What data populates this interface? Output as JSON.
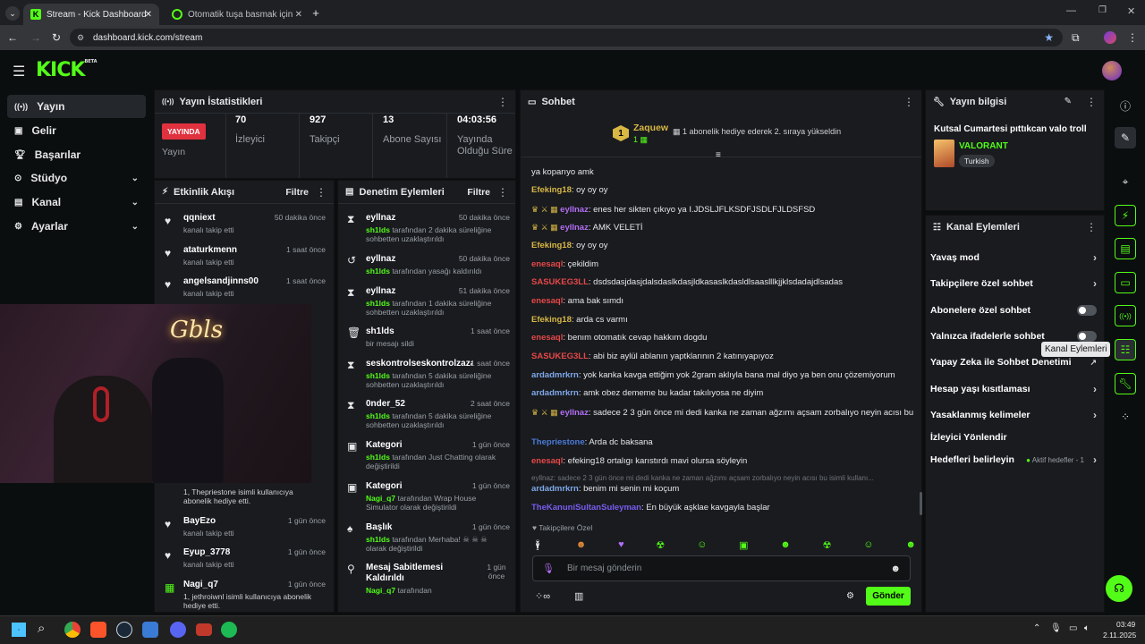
{
  "browser": {
    "tabs": [
      {
        "title": "Stream - Kick Dashboard"
      },
      {
        "title": "Otomatik tuşa basmak için prog..."
      }
    ],
    "url": "dashboard.kick.com/stream"
  },
  "kick": {
    "logo": "KICK",
    "beta": "BETA"
  },
  "nav": [
    {
      "label": "Yayın",
      "icon": "broadcast-icon"
    },
    {
      "label": "Gelir",
      "icon": "revenue-icon"
    },
    {
      "label": "Başarılar",
      "icon": "trophy-icon"
    },
    {
      "label": "Stüdyo",
      "icon": "studio-icon"
    },
    {
      "label": "Kanal",
      "icon": "channel-icon"
    },
    {
      "label": "Ayarlar",
      "icon": "settings-icon"
    }
  ],
  "stats": {
    "title": "Yayın İstatistikleri",
    "live_badge": "YAYINDA",
    "live_label": "Yayın",
    "viewers": "70",
    "viewers_label": "İzleyici",
    "followers": "927",
    "followers_label": "Takipçi",
    "subs": "13",
    "subs_label": "Abone Sayısı",
    "duration": "04:03:56",
    "duration_label": "Yayında Olduğu Süre"
  },
  "activity": {
    "title": "Etkinlik Akışı",
    "filter": "Filtre",
    "items": [
      {
        "name": "qqniext",
        "sub": "kanalı takip etti",
        "time": "50 dakika önce"
      },
      {
        "name": "ataturkmenn",
        "sub": "kanalı takip etti",
        "time": "1 saat önce"
      },
      {
        "name": "angelsandjinns00",
        "sub": "kanalı takip etti",
        "time": "1 saat önce"
      },
      {
        "name": "",
        "sub": "1, Thepriestone isimli kullanıcıya abonelik hediye etti.",
        "time": ""
      },
      {
        "name": "BayEzo",
        "sub": "kanalı takip etti",
        "time": "1 gün önce"
      },
      {
        "name": "Eyup_3778",
        "sub": "kanalı takip etti",
        "time": "1 gün önce"
      },
      {
        "name": "Nagi_q7",
        "sub": "1, jethroiwnl isimli kullanıcıya abonelik hediye etti.",
        "time": "1 gün önce"
      }
    ]
  },
  "moderation": {
    "title": "Denetim Eylemleri",
    "filter": "Filtre",
    "items": [
      {
        "name": "eyllnaz",
        "by": "sh1lds",
        "sub": "tarafından 2 dakika süreliğine sohbetten uzaklaştırıldı",
        "time": "50 dakika önce"
      },
      {
        "name": "eyllnaz",
        "by": "sh1lds",
        "sub": "tarafından yasağı kaldırıldı",
        "time": "50 dakika önce"
      },
      {
        "name": "eyllnaz",
        "by": "sh1lds",
        "sub": "tarafından 1 dakika süreliğine sohbetten uzaklaştırıldı",
        "time": "51 dakika önce"
      },
      {
        "name": "sh1lds",
        "by": "",
        "sub": "bir mesajı sildi",
        "time": "1 saat önce"
      },
      {
        "name": "seskontrolseskontrolzaza",
        "by": "sh1lds",
        "sub": "tarafından 5 dakika süreliğine sohbetten uzaklaştırıldı",
        "time": "1 saat önce"
      },
      {
        "name": "0nder_52",
        "by": "sh1lds",
        "sub": "tarafından 5 dakika süreliğine sohbetten uzaklaştırıldı",
        "time": "2 saat önce"
      },
      {
        "name": "Kategori",
        "by": "sh1lds",
        "sub": "tarafından Just Chatting olarak değiştirildi",
        "time": "1 gün önce"
      },
      {
        "name": "Kategori",
        "by": "Nagi_q7",
        "sub": "tarafından Wrap House Simulator olarak değiştirildi",
        "time": "1 gün önce"
      },
      {
        "name": "Başlık",
        "by": "sh1lds",
        "sub": "tarafından Merhaba! ☠ ☠ ☠ olarak değiştirildi",
        "time": "1 gün önce"
      },
      {
        "name": "Mesaj Sabitlemesi Kaldırıldı",
        "by": "Nagi_q7",
        "sub": "tarafından",
        "time": "1 gün önce"
      }
    ]
  },
  "chat": {
    "title": "Sohbet",
    "pinned_user": "Zaquew",
    "pinned_count": "1",
    "pinned_text": "1 abonelik hediye ederek 2. sıraya yükseldin",
    "messages": [
      {
        "user": "",
        "color": "#e6e7e8",
        "text": "ya koparıyo amk"
      },
      {
        "user": "Efeking18",
        "color": "#d8b744",
        "text": "oy oy oy"
      },
      {
        "user": "eyllnaz",
        "color": "#b46ef5",
        "text": "enes her sikten çıkıyo ya I.JDSLJFLKSDFJSDLFJLDSFSD",
        "badges": true
      },
      {
        "user": "eyllnaz",
        "color": "#b46ef5",
        "text": "AMK VELETİ",
        "badges": true
      },
      {
        "user": "Efeking18",
        "color": "#d8b744",
        "text": "oy oy oy"
      },
      {
        "user": "enesaql",
        "color": "#e64848",
        "text": "çekildim"
      },
      {
        "user": "SASUKEG3LL",
        "color": "#e64848",
        "text": "dsdsdasjdasjdalsdaslkdasjldkasaslkdasldlsaaslllkjjklsdadajdlsadas"
      },
      {
        "user": "enesaql",
        "color": "#e64848",
        "text": "ama bak sımdı"
      },
      {
        "user": "Efeking18",
        "color": "#d8b744",
        "text": "arda cs varmı"
      },
      {
        "user": "enesaql",
        "color": "#e64848",
        "text": "benım otomatık cevap hakkım dogdu"
      },
      {
        "user": "SASUKEG3LL",
        "color": "#e64848",
        "text": "abi biz aylül ablanın yaptklarının 2 katınıyapıyoz"
      },
      {
        "user": "ardadmrkrn",
        "color": "#7fa8e8",
        "text": "yok kanka kavga ettiğim yok 2gram aklıyla bana mal diyo ya ben onu çözemiyorum"
      },
      {
        "user": "ardadmrkrn",
        "color": "#7fa8e8",
        "text": "amk obez dememe bu kadar takılıyosa ne diyim"
      },
      {
        "user": "eyllnaz",
        "color": "#b46ef5",
        "text": "sadece 2 3 gün önce mi dedi kanka ne zaman ağzımı açsam zorbalıyo neyin acısı bu",
        "badges": true
      },
      {
        "user": "Thepriestone",
        "color": "#4a7bd8",
        "text": "Arda dc baksana"
      },
      {
        "user": "enesaql",
        "color": "#e64848",
        "text": "efeking18 ortalıgı karıstırdı mavi olursa söyleyin"
      },
      {
        "user": "ardadmrkrn",
        "color": "#7fa8e8",
        "text": "benim mi senin mi koçum",
        "reply": "eyllnaz: sadece 2 3 gün önce mi dedi kanka ne zaman ağzımı açsam zorbalıyo neyin acısı bu isimli kullanı..."
      },
      {
        "user": "TheKanuniSultanSuleyman",
        "color": "#7a5cf0",
        "text": "En büyük aşklae kavgayla başlar"
      }
    ],
    "mode_label": "Takipçilere Özel",
    "input_placeholder": "Bir mesaj gönderin",
    "send": "Gönder"
  },
  "stream_info": {
    "title": "Yayın bilgisi",
    "stream_title": "Kutsal Cumartesi pıttıkcan valo troll",
    "category": "VALORANT",
    "language": "Turkish"
  },
  "channel_actions": {
    "title": "Kanal Eylemleri",
    "tooltip": "Kanal Eylemleri",
    "items": [
      {
        "label": "Yavaş mod",
        "kind": "chevron"
      },
      {
        "label": "Takipçilere özel sohbet",
        "kind": "chevron"
      },
      {
        "label": "Abonelere özel sohbet",
        "kind": "toggle"
      },
      {
        "label": "Yalnızca ifadelerle sohbet",
        "kind": "toggle"
      },
      {
        "label": "Yapay Zeka ile Sohbet Denetimi",
        "kind": "external"
      },
      {
        "label": "Hesap yaşı kısıtlaması",
        "kind": "chevron"
      },
      {
        "label": "Yasaklanmış kelimeler",
        "kind": "chevron"
      },
      {
        "label": "İzleyici Yönlendir",
        "kind": "none"
      },
      {
        "label": "Hedefleri belirleyin",
        "kind": "chevron",
        "extra": "Aktif hedefler - 1"
      }
    ]
  },
  "taskbar": {
    "time": "03:49",
    "date": "2.11.2025"
  },
  "colors": {
    "kick_green": "#53fc18",
    "live_red": "#e0313f",
    "panel_bg": "#191b1f"
  }
}
